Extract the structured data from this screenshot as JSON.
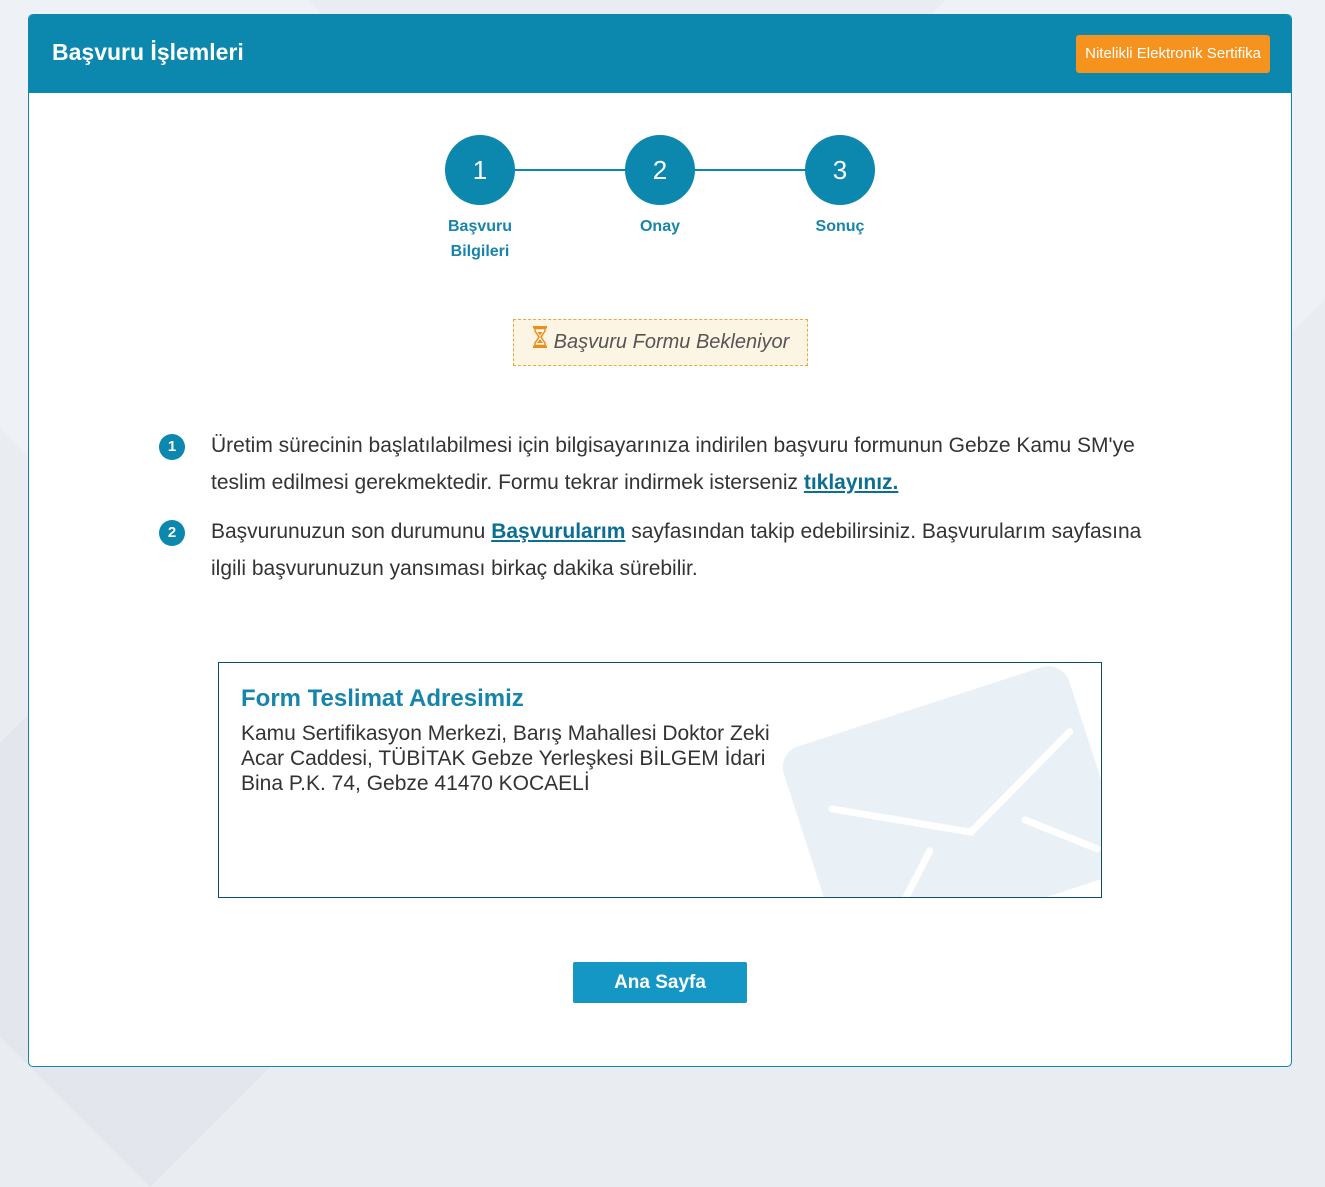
{
  "header": {
    "title": "Başvuru İşlemleri",
    "cert_button": "Nitelikli Elektronik Sertifika"
  },
  "steps": [
    {
      "number": "1",
      "label": "Başvuru Bilgileri"
    },
    {
      "number": "2",
      "label": "Onay"
    },
    {
      "number": "3",
      "label": "Sonuç"
    }
  ],
  "status": {
    "text": "Başvuru Formu Bekleniyor",
    "icon": "hourglass-icon"
  },
  "info": [
    {
      "number": "1",
      "text_before": "Üretim sürecinin başlatılabilmesi için bilgisayarınıza indirilen başvuru formunun Gebze Kamu SM'ye teslim edilmesi gerekmektedir. Formu tekrar indirmek isterseniz ",
      "link": "tıklayınız.",
      "text_after": ""
    },
    {
      "number": "2",
      "text_before": "Başvurunuzun son durumunu ",
      "link": "Başvurularım",
      "text_after": " sayfasından takip edebilirsiniz. Başvurularım sayfasına ilgili başvurunuzun yansıması birkaç dakika sürebilir."
    }
  ],
  "address": {
    "title": "Form Teslimat Adresimiz",
    "text": "Kamu Sertifikasyon Merkezi, Barış Mahallesi Doktor Zeki Acar Caddesi, TÜBİTAK Gebze Yerleşkesi BİLGEM İdari Bina P.K. 74, Gebze 41470 KOCAELİ",
    "icon": "envelope-icon"
  },
  "home_button": "Ana Sayfa",
  "colors": {
    "primary": "#0c87ad",
    "accent": "#f6921e",
    "button": "#1497c4",
    "status_border": "#f0a43a"
  }
}
